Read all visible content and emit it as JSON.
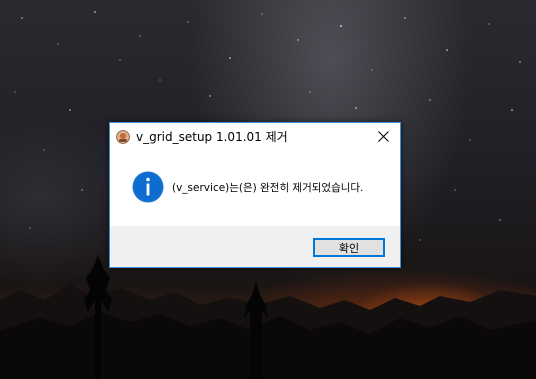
{
  "desktop": {
    "wallpaper": "night-sky-milky-way-sunset-mountains"
  },
  "dialog": {
    "title": "v_grid_setup 1.01.01 제거",
    "app_icon": "setup-app-icon",
    "close_icon": "close-icon",
    "info_icon": "info-icon",
    "message": "(v_service)는(은) 완전히 제거되었습니다.",
    "ok_label": "확인",
    "accent_color": "#0078d7"
  }
}
